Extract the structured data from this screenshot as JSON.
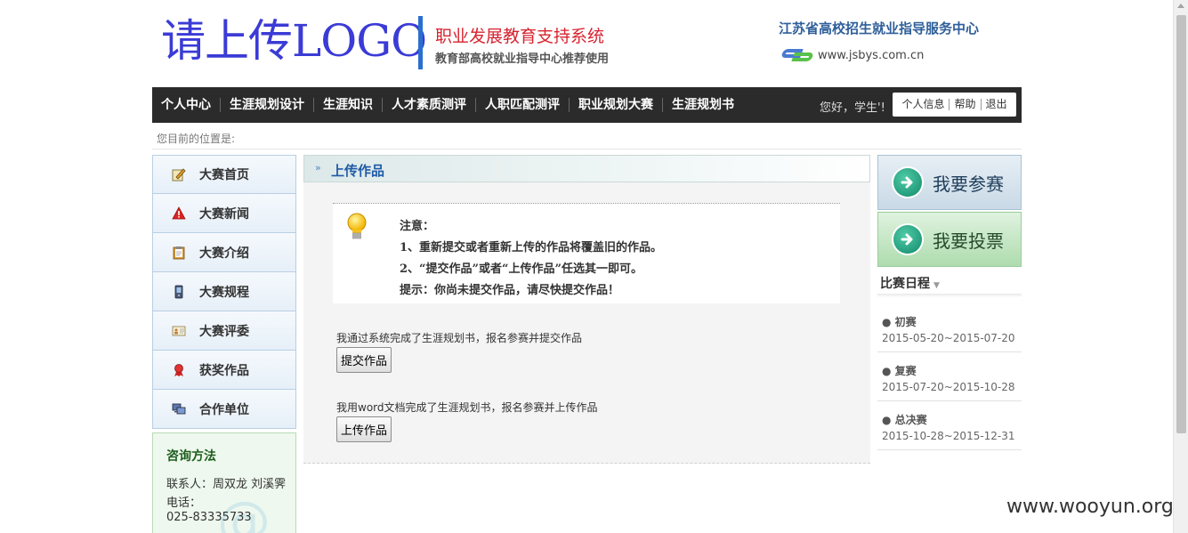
{
  "header": {
    "logo_text": "请上传LOGO",
    "system_title": "职业发展教育支持系统",
    "system_subtitle": "教育部高校就业指导中心推荐使用",
    "center_name": "江苏省高校招生就业指导服务中心",
    "site_url": "www.jsbys.com.cn"
  },
  "nav": {
    "items": [
      "个人中心",
      "生涯规划设计",
      "生涯知识",
      "人才素质测评",
      "人职匹配测评",
      "职业规划大赛",
      "生涯规划书"
    ],
    "greeting": "您好，学生'!",
    "user_links": [
      "个人信息",
      "帮助",
      "退出"
    ]
  },
  "breadcrumb": "您目前的位置是:",
  "sidebar": {
    "items": [
      {
        "label": "大赛首页",
        "icon": "edit-icon"
      },
      {
        "label": "大赛新闻",
        "icon": "warning-icon"
      },
      {
        "label": "大赛介绍",
        "icon": "clipboard-icon"
      },
      {
        "label": "大赛规程",
        "icon": "phone-icon"
      },
      {
        "label": "大赛评委",
        "icon": "id-card-icon"
      },
      {
        "label": "获奖作品",
        "icon": "medal-icon"
      },
      {
        "label": "合作单位",
        "icon": "computer-icon"
      }
    ],
    "contact": {
      "title": "咨询方法",
      "person": "联系人：周双龙 刘溪霁",
      "tel_label": "电话：",
      "tel": "025-83335733"
    }
  },
  "main": {
    "title": "上传作品",
    "notice": {
      "label": "注意：",
      "line1": "1、重新提交或者重新上传的作品将覆盖旧的作品。",
      "line2": "2、“提交作品”或者“上传作品”任选其一即可。",
      "hint": "提示：你尚未提交作品，请尽快提交作品！"
    },
    "option1": {
      "text": "我通过系统完成了生涯规划书，报名参赛并提交作品",
      "button": "提交作品"
    },
    "option2": {
      "text": "我用word文档完成了生涯规划书，报名参赛并上传作品",
      "button": "上传作品"
    }
  },
  "right": {
    "join_label": "我要参赛",
    "vote_label": "我要投票",
    "schedule_title": "比赛日程",
    "schedule": [
      {
        "name": "初赛",
        "dates": "2015-05-20~2015-07-20"
      },
      {
        "name": "复赛",
        "dates": "2015-07-20~2015-10-28"
      },
      {
        "name": "总决赛",
        "dates": "2015-10-28~2015-12-31"
      }
    ]
  },
  "watermark": "www.wooyun.org",
  "colors": {
    "nav_bg": "#2b2b2b",
    "logo": "#3b3bd6",
    "system_title": "#d7232f",
    "link_blue": "#1f5aa6"
  }
}
